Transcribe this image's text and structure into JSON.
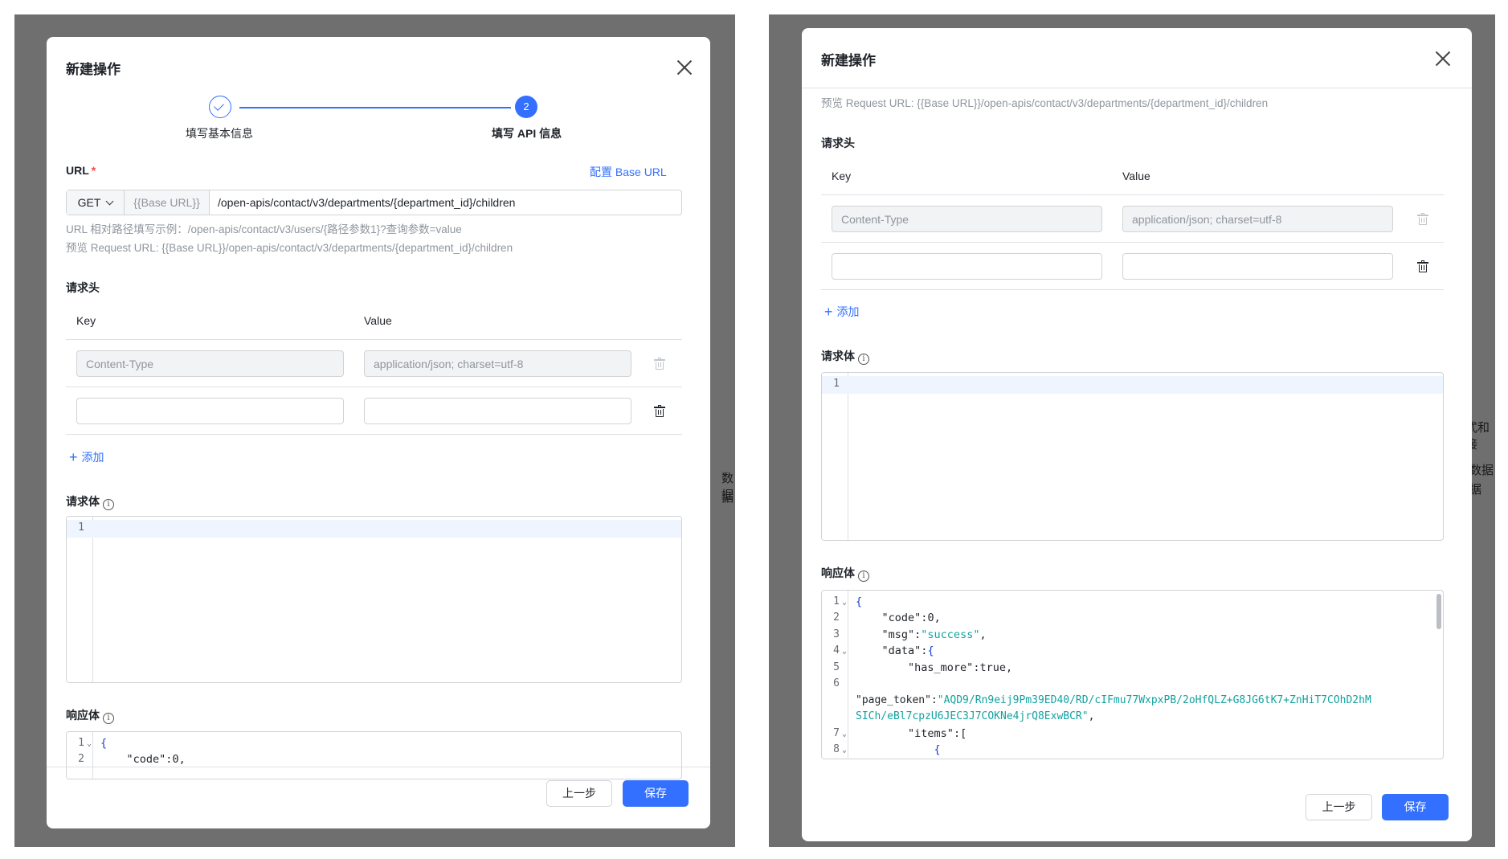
{
  "modal": {
    "title": "新建操作",
    "steps": [
      {
        "label": "填写基本信息",
        "status": "done"
      },
      {
        "number": "2",
        "label": "填写 API 信息",
        "status": "active"
      }
    ],
    "url": {
      "label": "URL",
      "required_mark": "*",
      "config_link": "配置 Base URL",
      "method": "GET",
      "base_url": "{{Base URL}}",
      "path": "/open-apis/contact/v3/departments/{department_id}/children",
      "hint_example": "URL 相对路径填写示例：/open-apis/contact/v3/users/{路径参数1}?查询参数=value",
      "hint_preview": "预览 Request URL: {{Base URL}}/open-apis/contact/v3/departments/{department_id}/children"
    },
    "headers": {
      "label": "请求头",
      "col_key": "Key",
      "col_value": "Value",
      "rows": [
        {
          "key": "Content-Type",
          "value": "application/json; charset=utf-8",
          "disabled": true
        },
        {
          "key": "",
          "value": "",
          "disabled": false
        }
      ],
      "add_label": "添加"
    },
    "request_body": {
      "label": "请求体",
      "lines": [
        "1"
      ]
    },
    "response_body": {
      "label": "响应体",
      "line_numbers": [
        "1",
        "2",
        "3",
        "4",
        "5",
        "6",
        "7",
        "8"
      ],
      "code": {
        "l1": "{",
        "code_key": "\"code\"",
        "code_val": "0",
        "msg_key": "\"msg\"",
        "msg_val": "\"success\"",
        "data_key": "\"data\"",
        "data_open": "{",
        "has_more_key": "\"has_more\"",
        "has_more_val": "true",
        "page_token_key": "\"page_token\"",
        "page_token_val_1": "\"AQD9/Rn9eij9Pm39ED40/RD/cIFmu77WxpxPB/2oHfQLZ+G8JG6tK7+ZnHiT7COhD2hM",
        "page_token_val_2": "SICh/eBl7cpzU6JEC3J7COKNe4jrQ8ExwBCR\"",
        "items_key": "\"items\"",
        "items_open": "[",
        "l8": "{"
      }
    },
    "footer": {
      "prev_label": "上一步",
      "save_label": "保存"
    }
  },
  "background_fragments": [
    "式和接",
    "数据",
    "据"
  ],
  "colors": {
    "accent": "#3370ff",
    "overlay": "#6f6f6f",
    "string": "#11a39f"
  }
}
